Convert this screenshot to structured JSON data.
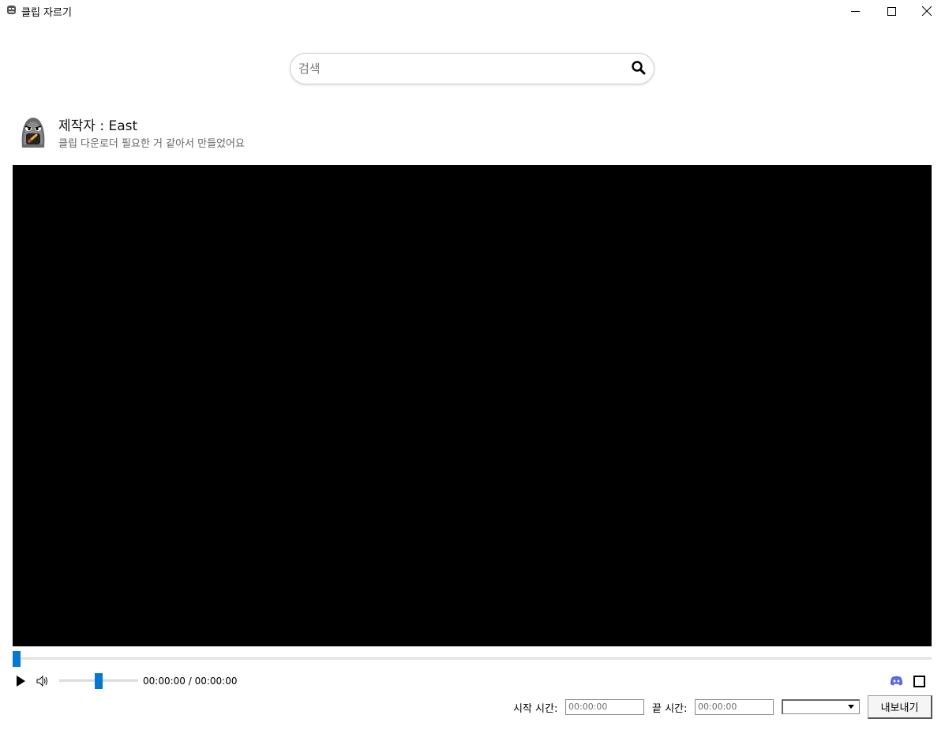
{
  "window": {
    "title": "클립 자르기",
    "icons": {
      "app": "app-logo-icon",
      "minimize": "minimize-icon",
      "maximize": "maximize-icon",
      "close": "close-icon"
    }
  },
  "search": {
    "placeholder": "검색",
    "value": "",
    "icon": "search-icon"
  },
  "creator": {
    "name": "제작자 : East",
    "description": "클립 다운로더 필요한 거 같아서 만들었어요"
  },
  "player": {
    "time_display": "00:00:00 / 00:00:00",
    "seek_position": 0,
    "volume_level": 0.5,
    "icons": [
      "play-icon",
      "volume-icon",
      "discord-icon",
      "fullscreen-icon"
    ]
  },
  "export": {
    "start_label": "시작 시간:",
    "start_placeholder": "00:00:00",
    "end_label": "끝 시간:",
    "end_placeholder": "00:00:00",
    "format_selected": "",
    "button_label": "내보내기"
  },
  "colors": {
    "accent": "#0078d7",
    "video_background": "#000000",
    "discord": "#5865F2"
  }
}
